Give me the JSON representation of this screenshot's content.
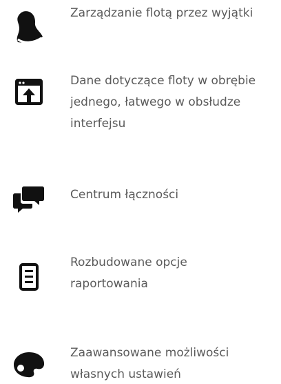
{
  "features": [
    {
      "icon": "bell-icon",
      "text": "Zarządzanie flotą przez wyjątki"
    },
    {
      "icon": "browser-upload-icon",
      "text": "Dane dotyczące floty w obrębie\njednego, łatwego w obsłudze\ninterfejsu"
    },
    {
      "icon": "chat-bubbles-icon",
      "text": "Centrum łączności"
    },
    {
      "icon": "document-list-icon",
      "text": "Rozbudowane opcje\nraportowania"
    },
    {
      "icon": "palette-icon",
      "text": "Zaawansowane możliwości\nwłasnych ustawień"
    }
  ],
  "colors": {
    "icon": "#111111",
    "text": "#5b5b5b",
    "background": "#ffffff"
  }
}
